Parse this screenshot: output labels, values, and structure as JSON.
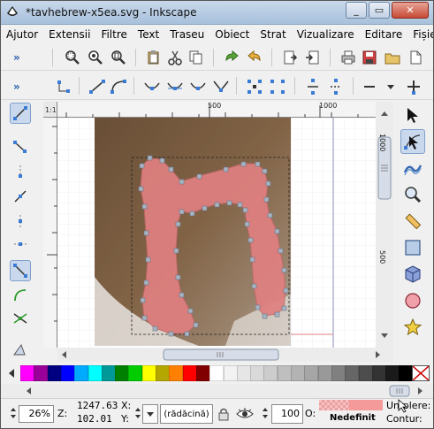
{
  "window": {
    "title": "*tavhebrew-x5ea.svg - Inkscape",
    "minimize_label": "_",
    "maximize_label": "▭",
    "close_label": "✕"
  },
  "menubar": {
    "items": [
      "Ajutor",
      "Extensii",
      "Filtre",
      "Text",
      "Traseu",
      "Obiect",
      "Strat",
      "Vizualizare",
      "Editare",
      "Fișier"
    ]
  },
  "toolbar": {
    "overflow_label": "»"
  },
  "node_toolbar": {
    "overflow_label": "»"
  },
  "rulers": {
    "h_ticks": [
      "500",
      "1000"
    ],
    "v_ticks": [
      "1000",
      "500"
    ]
  },
  "palette": {
    "colors": [
      "#ff00ff",
      "#990099",
      "#000080",
      "#0000ff",
      "#00aaff",
      "#00ffff",
      "#009999",
      "#008000",
      "#00cc00",
      "#ffff00",
      "#b3a700",
      "#ff8000",
      "#ff0000",
      "#800000",
      "#ffffff",
      "#f2f2f2",
      "#e6e6e6",
      "#d9d9d9",
      "#cccccc",
      "#bfbfbf",
      "#b3b3b3",
      "#a6a6a6",
      "#999999",
      "#808080",
      "#666666",
      "#4d4d4d",
      "#333333",
      "#1a1a1a",
      "#000000"
    ],
    "none_label": "X"
  },
  "statusbar": {
    "zoom_value": "26%",
    "zoom_label": "Z:",
    "x_value": "1247.63",
    "x_label": "X:",
    "y_value": "102.01",
    "y_label": "Y:",
    "layer_label": "(rădăcină)",
    "opacity_value": "100",
    "opacity_label": "O:",
    "fill_label": "Umplere:",
    "stroke_label": "Contur:",
    "undefined_label": "Nedefinit",
    "fill_color": "#f59a9a"
  },
  "colors": {
    "accent": "#2a5db0",
    "shape_fill": "#e08080",
    "node": "#a8b4c2"
  }
}
